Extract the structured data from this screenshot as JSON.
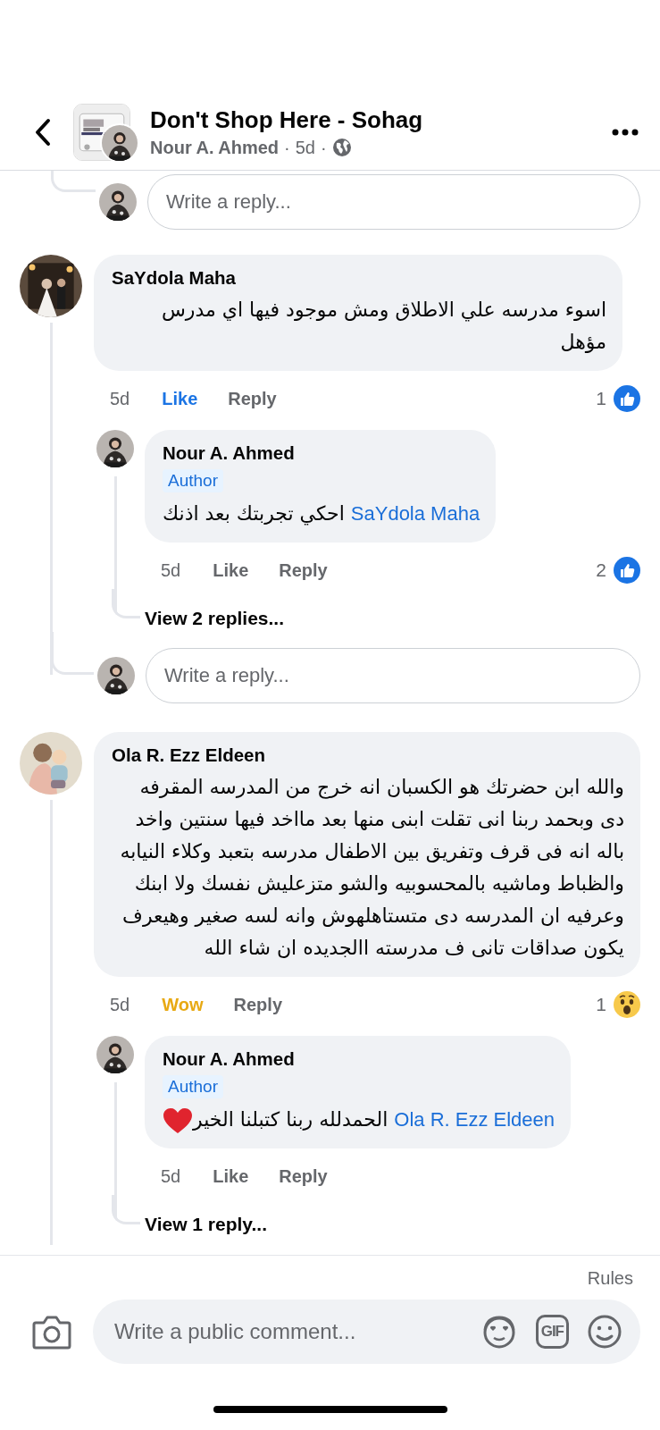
{
  "header": {
    "title": "Don't Shop Here - Sohag",
    "author": "Nour A. Ahmed",
    "separator": "·",
    "time": "5d"
  },
  "top_reply_field": {
    "placeholder": "Write a reply..."
  },
  "comments": [
    {
      "author": "SaYdola Maha",
      "text": "اسوء مدرسه علي الاطلاق ومش موجود فيها اي مدرس مؤهل",
      "time": "5d",
      "reaction_label": "Like",
      "reacted": true,
      "reply_label": "Reply",
      "summary": {
        "count": "1",
        "kind": "like"
      },
      "replies": [
        {
          "kind": "plain",
          "author": "Nour A. Ahmed",
          "badge": "Author",
          "mention": "SaYdola Maha",
          "text": "احكي تجربتك بعد اذنك",
          "time": "5d",
          "reaction_label": "Like",
          "reacted": false,
          "reply_label": "Reply",
          "summary": {
            "count": "2",
            "kind": "like"
          },
          "view_replies": "View 2 replies..."
        }
      ],
      "reply_field": {
        "placeholder": "Write a reply..."
      }
    },
    {
      "author": "Ola R. Ezz Eldeen",
      "text": "والله ابن حضرتك هو الكسبان انه خرج من المدرسه المقرفه دى وبحمد ربنا انى تقلت ابنى منها بعد مااخد فيها سنتين واخد باله انه فى قرف وتفريق بين الاطفال مدرسه بتعبد وكلاء النيابه والظباط وماشيه بالمحسوبيه والشو متزعليش نفسك ولا ابنك وعرفيه ان المدرسه دى متستاهلهوش وانه لسه صغير وهيعرف يكون صداقات تانى ف مدرسته االجديده ان شاء الله",
      "time": "5d",
      "reaction_label": "Wow",
      "reacted": true,
      "reply_label": "Reply",
      "summary": {
        "count": "1",
        "kind": "wow"
      },
      "replies": [
        {
          "kind": "heart",
          "author": "Nour A. Ahmed",
          "badge": "Author",
          "mention": "Ola R. Ezz Eldeen",
          "text": "الحمدلله ربنا كتبلنا الخير",
          "time": "5d",
          "reaction_label": "Like",
          "reacted": false,
          "reply_label": "Reply",
          "view_replies": "View 1 reply..."
        }
      ]
    }
  ],
  "footer": {
    "rules": "Rules",
    "placeholder": "Write a public comment...",
    "gif": "GIF"
  }
}
